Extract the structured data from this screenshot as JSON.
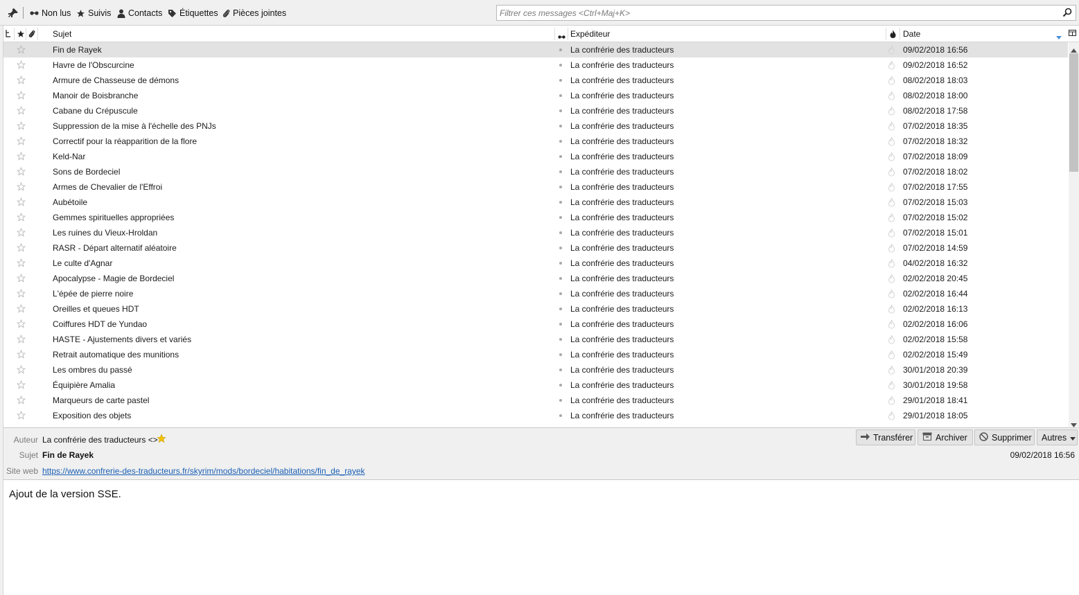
{
  "toolbar": {
    "unread_label": "Non lus",
    "starred_label": "Suivis",
    "contacts_label": "Contacts",
    "tags_label": "Étiquettes",
    "attachments_label": "Pièces jointes",
    "filter_placeholder": "Filtrer ces messages <Ctrl+Maj+K>"
  },
  "columns": {
    "subject": "Sujet",
    "sender": "Expéditeur",
    "date": "Date"
  },
  "messages": [
    {
      "subject": "Fin de Rayek",
      "sender": "La confrérie des traducteurs",
      "date": "09/02/2018 16:56",
      "selected": true
    },
    {
      "subject": "Havre de l'Obscurcine",
      "sender": "La confrérie des traducteurs",
      "date": "09/02/2018 16:52"
    },
    {
      "subject": "Armure de Chasseuse de démons",
      "sender": "La confrérie des traducteurs",
      "date": "08/02/2018 18:03"
    },
    {
      "subject": "Manoir de Boisbranche",
      "sender": "La confrérie des traducteurs",
      "date": "08/02/2018 18:00"
    },
    {
      "subject": "Cabane du Crépuscule",
      "sender": "La confrérie des traducteurs",
      "date": "08/02/2018 17:58"
    },
    {
      "subject": "Suppression de la mise à l'échelle des PNJs",
      "sender": "La confrérie des traducteurs",
      "date": "07/02/2018 18:35"
    },
    {
      "subject": "Correctif pour la réapparition de la flore",
      "sender": "La confrérie des traducteurs",
      "date": "07/02/2018 18:32"
    },
    {
      "subject": "Keld-Nar",
      "sender": "La confrérie des traducteurs",
      "date": "07/02/2018 18:09"
    },
    {
      "subject": "Sons de Bordeciel",
      "sender": "La confrérie des traducteurs",
      "date": "07/02/2018 18:02"
    },
    {
      "subject": "Armes de Chevalier de l'Effroi",
      "sender": "La confrérie des traducteurs",
      "date": "07/02/2018 17:55"
    },
    {
      "subject": "Aubétoile",
      "sender": "La confrérie des traducteurs",
      "date": "07/02/2018 15:03"
    },
    {
      "subject": "Gemmes spirituelles appropriées",
      "sender": "La confrérie des traducteurs",
      "date": "07/02/2018 15:02"
    },
    {
      "subject": "Les ruines du Vieux-Hroldan",
      "sender": "La confrérie des traducteurs",
      "date": "07/02/2018 15:01"
    },
    {
      "subject": "RASR - Départ alternatif aléatoire",
      "sender": "La confrérie des traducteurs",
      "date": "07/02/2018 14:59"
    },
    {
      "subject": "Le culte d'Agnar",
      "sender": "La confrérie des traducteurs",
      "date": "04/02/2018 16:32"
    },
    {
      "subject": "Apocalypse - Magie de Bordeciel",
      "sender": "La confrérie des traducteurs",
      "date": "02/02/2018 20:45"
    },
    {
      "subject": "L'épée de pierre noire",
      "sender": "La confrérie des traducteurs",
      "date": "02/02/2018 16:44"
    },
    {
      "subject": "Oreilles et queues HDT",
      "sender": "La confrérie des traducteurs",
      "date": "02/02/2018 16:13"
    },
    {
      "subject": "Coiffures HDT de Yundao",
      "sender": "La confrérie des traducteurs",
      "date": "02/02/2018 16:06"
    },
    {
      "subject": "HASTE - Ajustements divers et variés",
      "sender": "La confrérie des traducteurs",
      "date": "02/02/2018 15:58"
    },
    {
      "subject": "Retrait automatique des munitions",
      "sender": "La confrérie des traducteurs",
      "date": "02/02/2018 15:49"
    },
    {
      "subject": "Les ombres du passé",
      "sender": "La confrérie des traducteurs",
      "date": "30/01/2018 20:39"
    },
    {
      "subject": "Équipière Amalia",
      "sender": "La confrérie des traducteurs",
      "date": "30/01/2018 19:58"
    },
    {
      "subject": "Marqueurs de carte pastel",
      "sender": "La confrérie des traducteurs",
      "date": "29/01/2018 18:41"
    },
    {
      "subject": "Exposition des objets",
      "sender": "La confrérie des traducteurs",
      "date": "29/01/2018 18:05"
    }
  ],
  "header": {
    "author_label": "Auteur",
    "author_value": "La confrérie des traducteurs <>",
    "subject_label": "Sujet",
    "subject_value": "Fin de Rayek",
    "website_label": "Site web",
    "website_value": "https://www.confrerie-des-traducteurs.fr/skyrim/mods/bordeciel/habitations/fin_de_rayek",
    "date_value": "09/02/2018 16:56",
    "forward_label": "Transférer",
    "archive_label": "Archiver",
    "delete_label": "Supprimer",
    "other_label": "Autres"
  },
  "body": {
    "text": "Ajout de la version SSE."
  },
  "colors": {
    "selected_row": "#e2e2e2",
    "link": "#1a5fb4",
    "star_gold": "#f2c200"
  }
}
